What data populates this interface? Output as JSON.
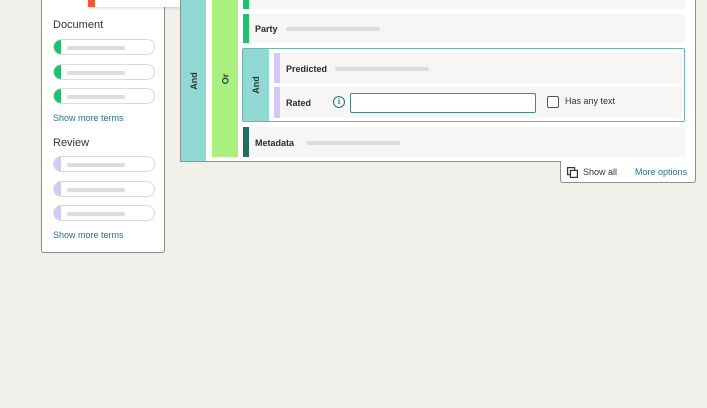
{
  "left_panel": {
    "document_title": "Document",
    "document_show_more": "Show more terms",
    "review_title": "Review",
    "review_show_more": "Show more terms"
  },
  "builder": {
    "outer_operator": "And",
    "inner_operator": "Or",
    "nested_operator": "And",
    "rows": {
      "party_label": "Party",
      "predicted_label": "Predicted",
      "rated_label": "Rated",
      "metadata_label": "Metadata"
    },
    "rated_input": {
      "value": "",
      "placeholder": ""
    },
    "has_any_text": {
      "label": "Has any text",
      "checked": false
    },
    "info_icon": "info-icon",
    "footer": {
      "show_all_label": "Show all",
      "more_options_label": "More options"
    }
  },
  "colors": {
    "document_term": "#1fc26b",
    "review_term": "#d6c8f2",
    "and_column": "#8fd8d3",
    "or_column": "#aaf07e",
    "metadata_accent": "#1f6e5e",
    "link": "#2b6f8c",
    "floating_chip_accent": "#f05a3a"
  }
}
